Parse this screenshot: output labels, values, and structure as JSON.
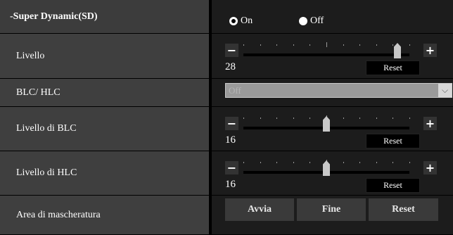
{
  "super_dynamic": {
    "title": "-Super Dynamic(SD)",
    "on_label": "On",
    "off_label": "Off",
    "selected": "On"
  },
  "livello": {
    "label": "Livello",
    "value": "28",
    "reset_label": "Reset",
    "level_fraction": 0.93
  },
  "blc_hlc": {
    "label": "BLC/ HLC",
    "selected_value": "Off",
    "arrow_icon": "chevron-down-icon"
  },
  "livello_blc": {
    "label": "Livello di BLC",
    "value": "16",
    "reset_label": "Reset",
    "level_fraction": 0.5
  },
  "livello_hlc": {
    "label": "Livello di HLC",
    "value": "16",
    "reset_label": "Reset",
    "level_fraction": 0.5
  },
  "area_mascheratura": {
    "label": "Area di mascheratura",
    "start_label": "Avvia",
    "end_label": "Fine",
    "reset_label": "Reset"
  },
  "slider_buttons": {
    "minus": "−",
    "plus": "+"
  }
}
